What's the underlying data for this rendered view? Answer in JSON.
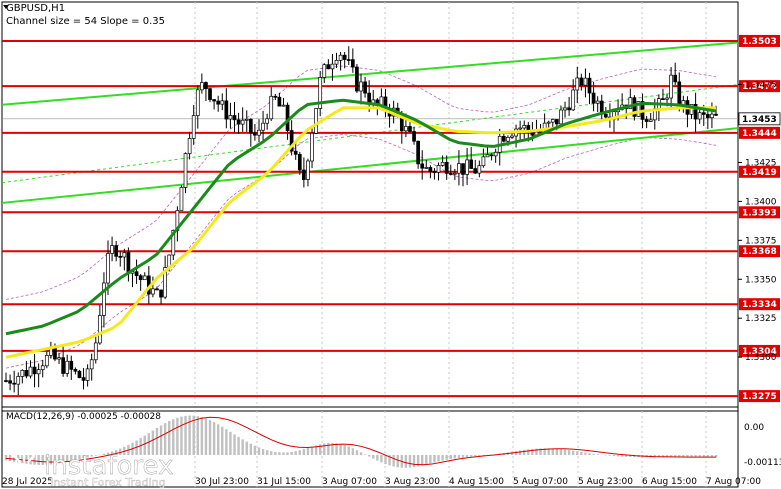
{
  "header": {
    "symbol": "GBPUSD,H1",
    "channel_info": "Channel size = 54 Slope = 0.35"
  },
  "macd": {
    "label": "MACD(12,26,9) -0.00025 -0.00028",
    "levels": [
      "0.00",
      "-0.00113"
    ]
  },
  "price_axis": {
    "ticks": [
      "1.3475",
      "1.3425",
      "1.3400",
      "1.3375",
      "1.3350",
      "1.3325",
      "1.3300"
    ],
    "tick_values": [
      1.3475,
      1.3425,
      1.34,
      1.3375,
      1.335,
      1.3325,
      1.33
    ],
    "min": 1.3268,
    "max": 1.3528
  },
  "levels": [
    {
      "label": "1.3503",
      "value": 1.3503
    },
    {
      "label": "1.3474",
      "value": 1.3474
    },
    {
      "label": "1.3444",
      "value": 1.3444
    },
    {
      "label": "1.3419",
      "value": 1.3419
    },
    {
      "label": "1.3393",
      "value": 1.3393
    },
    {
      "label": "1.3368",
      "value": 1.3368
    },
    {
      "label": "1.3334",
      "value": 1.3334
    },
    {
      "label": "1.3304",
      "value": 1.3304
    },
    {
      "label": "1.3275",
      "value": 1.3275
    }
  ],
  "current_price": {
    "label": "1.3453",
    "value": 1.3453
  },
  "time_axis": {
    "labels": [
      "28 Jul 2025",
      "30 Jul 23:00",
      "31 Jul 15:00",
      "3 Aug 07:00",
      "3 Aug 23:00",
      "4 Aug 15:00",
      "5 Aug 07:00",
      "5 Aug 23:00",
      "6 Aug 15:00",
      "7 Aug 07:00"
    ],
    "label_x": [
      2,
      195,
      257,
      322,
      385,
      449,
      513,
      578,
      642,
      706
    ]
  },
  "watermark": {
    "brand": "instaforex",
    "tagline": "Instant Forex Trading"
  },
  "colors": {
    "level_line": "#e00000",
    "channel": "#33dd22",
    "ma_fast": "#1a8a1a",
    "ma_slow": "#f2ea1a",
    "bollinger": "#c060c0",
    "macd_hist": "#c0c0c0",
    "macd_signal": "#dd0000"
  },
  "chart_data": {
    "type": "candlestick",
    "instrument": "GBPUSD",
    "timeframe": "H1",
    "close_path": [
      1.3285,
      1.3288,
      1.329,
      1.3294,
      1.3298,
      1.33,
      1.3296,
      1.3292,
      1.3288,
      1.3285,
      1.331,
      1.3355,
      1.3372,
      1.3366,
      1.3356,
      1.335,
      1.3344,
      1.3338,
      1.336,
      1.3395,
      1.343,
      1.3465,
      1.3476,
      1.3468,
      1.346,
      1.3455,
      1.345,
      1.3446,
      1.344,
      1.3458,
      1.3465,
      1.3455,
      1.343,
      1.341,
      1.3445,
      1.3478,
      1.349,
      1.3498,
      1.3488,
      1.3476,
      1.3472,
      1.346,
      1.3462,
      1.3458,
      1.345,
      1.344,
      1.3425,
      1.3419,
      1.3422,
      1.3424,
      1.3423,
      1.3421,
      1.342,
      1.3422,
      1.3432,
      1.3442,
      1.3446,
      1.3448,
      1.3446,
      1.3445,
      1.3447,
      1.345,
      1.3458,
      1.3468,
      1.3478,
      1.347,
      1.3462,
      1.3458,
      1.3462,
      1.3464,
      1.346,
      1.3455,
      1.3458,
      1.3462,
      1.3478,
      1.3463,
      1.3458,
      1.3454,
      1.3453,
      1.3453
    ],
    "ma_fast_path": [
      1.3315,
      1.332,
      1.333,
      1.335,
      1.3365,
      1.3395,
      1.3425,
      1.344,
      1.3462,
      1.3465,
      1.3462,
      1.3452,
      1.3438,
      1.3435,
      1.344,
      1.345,
      1.3457,
      1.3463,
      1.3462,
      1.3458
    ],
    "ma_slow_path": [
      1.33,
      1.3305,
      1.331,
      1.332,
      1.335,
      1.337,
      1.34,
      1.3418,
      1.3445,
      1.346,
      1.346,
      1.345,
      1.3445,
      1.3444,
      1.3445,
      1.3448,
      1.3452,
      1.3458,
      1.346,
      1.346
    ],
    "channel_upper": [
      1.3462,
      1.3502
    ],
    "channel_lower": [
      1.3399,
      1.3447
    ],
    "channel_mid": [
      1.3412,
      1.3475
    ]
  }
}
